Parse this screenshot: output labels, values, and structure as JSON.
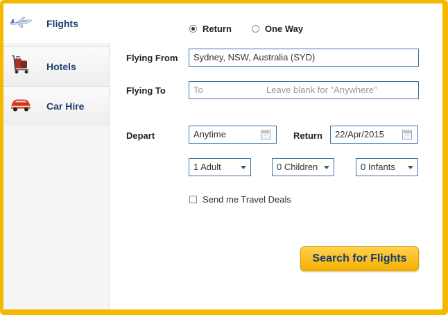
{
  "tabs": [
    {
      "label": "Flights",
      "icon": "airplane-icon",
      "active": true
    },
    {
      "label": "Hotels",
      "icon": "luggage-trolley-icon",
      "active": false
    },
    {
      "label": "Car Hire",
      "icon": "car-icon",
      "active": false
    }
  ],
  "trip_type": {
    "options": [
      "Return",
      "One Way"
    ],
    "selected": "Return"
  },
  "flying_from": {
    "label": "Flying From",
    "value": "Sydney, NSW, Australia (SYD)"
  },
  "flying_to": {
    "label": "Flying To",
    "placeholder": "To",
    "hint": "Leave blank for \"Anywhere\""
  },
  "depart": {
    "label": "Depart",
    "value": "Anytime",
    "icon": "calendar-icon"
  },
  "return_date": {
    "label": "Return",
    "value": "22/Apr/2015",
    "icon": "calendar-icon"
  },
  "passengers": {
    "adults": "1 Adult",
    "children": "0 Children",
    "infants": "0 Infants"
  },
  "travel_deals": {
    "label": "Send me Travel Deals",
    "checked": false
  },
  "search_button": {
    "label": "Search for Flights"
  },
  "colors": {
    "frame": "#f5b800",
    "field_border": "#3d6ea8",
    "tab_text": "#1a3b6e",
    "button": "#f5b000"
  }
}
